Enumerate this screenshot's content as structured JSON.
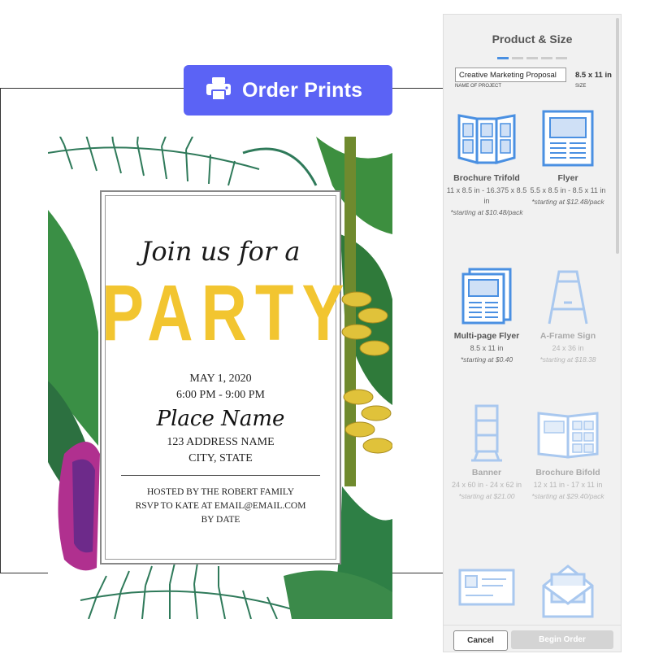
{
  "order_button": {
    "label": "Order Prints",
    "icon": "printer-icon",
    "color": "#5b63f5"
  },
  "invitation": {
    "heading_script": "Join us for a",
    "heading_main": "PARTY",
    "date": "MAY 1, 2020",
    "time": "6:00 PM - 9:00 PM",
    "place": "Place Name",
    "address": "123 ADDRESS NAME",
    "city": "CITY, STATE",
    "hosted": "HOSTED BY THE ROBERT FAMILY",
    "rsvp": "RSVP TO KATE AT EMAIL@EMAIL.COM",
    "by_date": "BY DATE",
    "accent_color": "#f2c530"
  },
  "panel": {
    "title": "Product & Size",
    "step_total": 5,
    "step_active": 1,
    "project_name": "Creative Marketing Proposal",
    "project_caption": "NAME OF PROJECT",
    "size_value": "8.5 x 11 in",
    "size_caption": "SIZE",
    "products": [
      {
        "name": "Brochure Trifold",
        "dims": "11 x 8.5 in - 16.375 x 8.5 in",
        "price": "*starting at $10.48/pack",
        "icon": "brochure-trifold-icon"
      },
      {
        "name": "Flyer",
        "dims": "5.5 x 8.5 in - 8.5 x 11 in",
        "price": "*starting at $12.48/pack",
        "icon": "flyer-icon"
      },
      {
        "name": "Multi-page Flyer",
        "dims": "8.5 x 11 in",
        "price": "*starting at $0.40",
        "icon": "multi-page-flyer-icon"
      },
      {
        "name": "A-Frame Sign",
        "dims": "24 x 36 in",
        "price": "*starting at $18.38",
        "icon": "a-frame-sign-icon"
      },
      {
        "name": "Banner",
        "dims": "24 x 60 in - 24 x 62 in",
        "price": "*starting at $21.00",
        "icon": "banner-stand-icon"
      },
      {
        "name": "Brochure Bifold",
        "dims": "12 x 11 in - 17 x 11 in",
        "price": "*starting at $29.40/pack",
        "icon": "brochure-bifold-icon"
      },
      {
        "name": "",
        "dims": "",
        "price": "",
        "icon": "business-card-icon"
      },
      {
        "name": "",
        "dims": "",
        "price": "",
        "icon": "envelope-icon"
      }
    ],
    "cancel_label": "Cancel",
    "begin_label": "Begin Order",
    "icon_color_active": "#4a90e2",
    "icon_color_dim": "#a9c8ef"
  }
}
